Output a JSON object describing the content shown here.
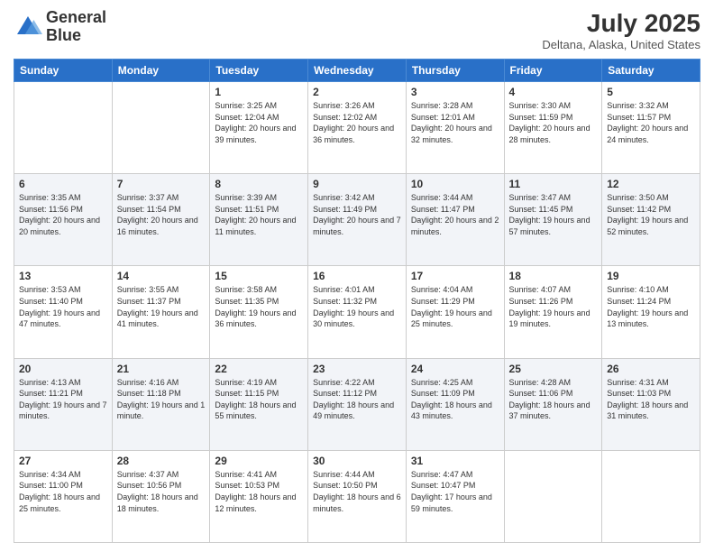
{
  "header": {
    "logo_line1": "General",
    "logo_line2": "Blue",
    "title": "July 2025",
    "location": "Deltana, Alaska, United States"
  },
  "days_of_week": [
    "Sunday",
    "Monday",
    "Tuesday",
    "Wednesday",
    "Thursday",
    "Friday",
    "Saturday"
  ],
  "weeks": [
    [
      {
        "day": "",
        "info": ""
      },
      {
        "day": "",
        "info": ""
      },
      {
        "day": "1",
        "info": "Sunrise: 3:25 AM\nSunset: 12:04 AM\nDaylight: 20 hours and 39 minutes."
      },
      {
        "day": "2",
        "info": "Sunrise: 3:26 AM\nSunset: 12:02 AM\nDaylight: 20 hours and 36 minutes."
      },
      {
        "day": "3",
        "info": "Sunrise: 3:28 AM\nSunset: 12:01 AM\nDaylight: 20 hours and 32 minutes."
      },
      {
        "day": "4",
        "info": "Sunrise: 3:30 AM\nSunset: 11:59 PM\nDaylight: 20 hours and 28 minutes."
      },
      {
        "day": "5",
        "info": "Sunrise: 3:32 AM\nSunset: 11:57 PM\nDaylight: 20 hours and 24 minutes."
      }
    ],
    [
      {
        "day": "6",
        "info": "Sunrise: 3:35 AM\nSunset: 11:56 PM\nDaylight: 20 hours and 20 minutes."
      },
      {
        "day": "7",
        "info": "Sunrise: 3:37 AM\nSunset: 11:54 PM\nDaylight: 20 hours and 16 minutes."
      },
      {
        "day": "8",
        "info": "Sunrise: 3:39 AM\nSunset: 11:51 PM\nDaylight: 20 hours and 11 minutes."
      },
      {
        "day": "9",
        "info": "Sunrise: 3:42 AM\nSunset: 11:49 PM\nDaylight: 20 hours and 7 minutes."
      },
      {
        "day": "10",
        "info": "Sunrise: 3:44 AM\nSunset: 11:47 PM\nDaylight: 20 hours and 2 minutes."
      },
      {
        "day": "11",
        "info": "Sunrise: 3:47 AM\nSunset: 11:45 PM\nDaylight: 19 hours and 57 minutes."
      },
      {
        "day": "12",
        "info": "Sunrise: 3:50 AM\nSunset: 11:42 PM\nDaylight: 19 hours and 52 minutes."
      }
    ],
    [
      {
        "day": "13",
        "info": "Sunrise: 3:53 AM\nSunset: 11:40 PM\nDaylight: 19 hours and 47 minutes."
      },
      {
        "day": "14",
        "info": "Sunrise: 3:55 AM\nSunset: 11:37 PM\nDaylight: 19 hours and 41 minutes."
      },
      {
        "day": "15",
        "info": "Sunrise: 3:58 AM\nSunset: 11:35 PM\nDaylight: 19 hours and 36 minutes."
      },
      {
        "day": "16",
        "info": "Sunrise: 4:01 AM\nSunset: 11:32 PM\nDaylight: 19 hours and 30 minutes."
      },
      {
        "day": "17",
        "info": "Sunrise: 4:04 AM\nSunset: 11:29 PM\nDaylight: 19 hours and 25 minutes."
      },
      {
        "day": "18",
        "info": "Sunrise: 4:07 AM\nSunset: 11:26 PM\nDaylight: 19 hours and 19 minutes."
      },
      {
        "day": "19",
        "info": "Sunrise: 4:10 AM\nSunset: 11:24 PM\nDaylight: 19 hours and 13 minutes."
      }
    ],
    [
      {
        "day": "20",
        "info": "Sunrise: 4:13 AM\nSunset: 11:21 PM\nDaylight: 19 hours and 7 minutes."
      },
      {
        "day": "21",
        "info": "Sunrise: 4:16 AM\nSunset: 11:18 PM\nDaylight: 19 hours and 1 minute."
      },
      {
        "day": "22",
        "info": "Sunrise: 4:19 AM\nSunset: 11:15 PM\nDaylight: 18 hours and 55 minutes."
      },
      {
        "day": "23",
        "info": "Sunrise: 4:22 AM\nSunset: 11:12 PM\nDaylight: 18 hours and 49 minutes."
      },
      {
        "day": "24",
        "info": "Sunrise: 4:25 AM\nSunset: 11:09 PM\nDaylight: 18 hours and 43 minutes."
      },
      {
        "day": "25",
        "info": "Sunrise: 4:28 AM\nSunset: 11:06 PM\nDaylight: 18 hours and 37 minutes."
      },
      {
        "day": "26",
        "info": "Sunrise: 4:31 AM\nSunset: 11:03 PM\nDaylight: 18 hours and 31 minutes."
      }
    ],
    [
      {
        "day": "27",
        "info": "Sunrise: 4:34 AM\nSunset: 11:00 PM\nDaylight: 18 hours and 25 minutes."
      },
      {
        "day": "28",
        "info": "Sunrise: 4:37 AM\nSunset: 10:56 PM\nDaylight: 18 hours and 18 minutes."
      },
      {
        "day": "29",
        "info": "Sunrise: 4:41 AM\nSunset: 10:53 PM\nDaylight: 18 hours and 12 minutes."
      },
      {
        "day": "30",
        "info": "Sunrise: 4:44 AM\nSunset: 10:50 PM\nDaylight: 18 hours and 6 minutes."
      },
      {
        "day": "31",
        "info": "Sunrise: 4:47 AM\nSunset: 10:47 PM\nDaylight: 17 hours and 59 minutes."
      },
      {
        "day": "",
        "info": ""
      },
      {
        "day": "",
        "info": ""
      }
    ]
  ]
}
